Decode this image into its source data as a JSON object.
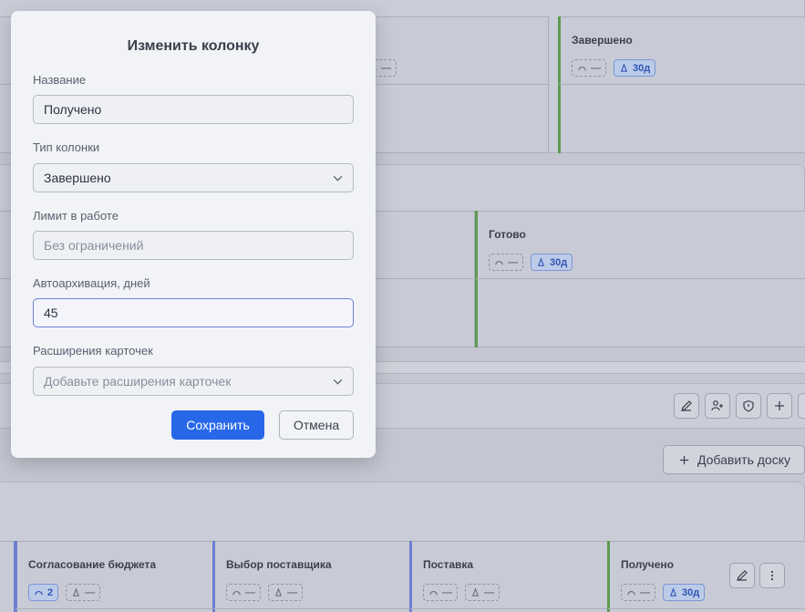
{
  "background": {
    "top_board": {
      "columns": [
        {
          "title": "",
          "chips": [
            {
              "icon": "gauge-icon",
              "value": "—",
              "active": false
            }
          ]
        },
        {
          "title": "Завершено",
          "chips": [
            {
              "icon": "gauge-icon",
              "value": "—",
              "active": false
            },
            {
              "icon": "archive-icon",
              "value": "30д",
              "active": true
            }
          ]
        }
      ]
    },
    "middle_board": {
      "columns": [
        {
          "title": "Готово",
          "chips": [
            {
              "icon": "gauge-icon",
              "value": "—",
              "active": false
            },
            {
              "icon": "archive-icon",
              "value": "30д",
              "active": true
            }
          ]
        }
      ]
    },
    "toolbar": {
      "icons": [
        "pencil-icon",
        "add-user-icon",
        "shield-icon",
        "plus-icon"
      ]
    },
    "add_board_label": "Добавить доску",
    "bottom_board": {
      "columns": [
        {
          "title": "Согласование бюджета",
          "accent": "#6e7fd0",
          "chips": [
            {
              "icon": "gauge-icon",
              "value": "2",
              "active": true
            },
            {
              "icon": "archive-icon",
              "value": "—",
              "active": false
            }
          ]
        },
        {
          "title": "Выбор поставщика",
          "accent": "#6e7fd0",
          "chips": [
            {
              "icon": "gauge-icon",
              "value": "—",
              "active": false
            },
            {
              "icon": "archive-icon",
              "value": "—",
              "active": false
            }
          ]
        },
        {
          "title": "Поставка",
          "accent": "#6e7fd0",
          "chips": [
            {
              "icon": "gauge-icon",
              "value": "—",
              "active": false
            },
            {
              "icon": "archive-icon",
              "value": "—",
              "active": false
            }
          ]
        },
        {
          "title": "Получено",
          "accent": "#5e9a52",
          "chips": [
            {
              "icon": "gauge-icon",
              "value": "—",
              "active": false
            },
            {
              "icon": "archive-icon",
              "value": "30д",
              "active": true
            }
          ]
        }
      ]
    }
  },
  "modal": {
    "title": "Изменить колонку",
    "name_label": "Название",
    "name_value": "Получено",
    "type_label": "Тип колонки",
    "type_value": "Завершено",
    "wip_label": "Лимит в работе",
    "wip_placeholder": "Без ограничений",
    "archive_label": "Автоархивация, дней",
    "archive_value": "45",
    "extensions_label": "Расширения карточек",
    "extensions_placeholder": "Добавьте расширения карточек",
    "save_label": "Сохранить",
    "cancel_label": "Отмена"
  },
  "colors": {
    "primary": "#2768e8",
    "accent_done": "#5e9a52",
    "accent_progress": "#6e7fd0"
  }
}
